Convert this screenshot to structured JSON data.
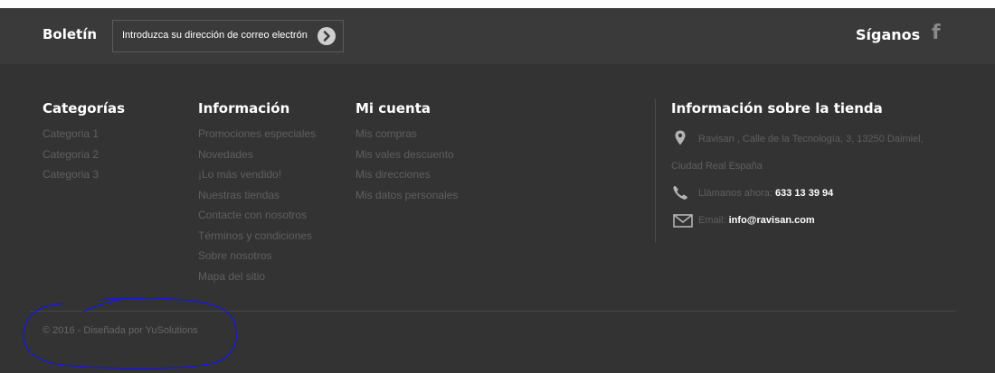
{
  "newsletter": {
    "title": "Boletín",
    "input_text": "Introduzca su dirección de correo electrón",
    "submit_icon": "chevron-right-circle-icon"
  },
  "social": {
    "title": "Síganos",
    "icon": "facebook-icon"
  },
  "columns": {
    "categorias": {
      "title": "Categorías",
      "items": [
        "Categoria 1",
        "Categoria 2",
        "Categoria 3"
      ]
    },
    "informacion": {
      "title": "Información",
      "items": [
        "Promociones especiales",
        "Novedades",
        "¡Lo más vendido!",
        "Nuestras tiendas",
        "Contacte con nosotros",
        "Términos y condiciones",
        "Sobre nosotros",
        "Mapa del sitio"
      ]
    },
    "cuenta": {
      "title": "Mi cuenta",
      "items": [
        "Mis compras",
        "Mis vales descuento",
        "Mis direcciones",
        "Mis datos personales"
      ]
    }
  },
  "store": {
    "title": "Información sobre la tienda",
    "address_line1": "Ravisan , Calle de la Tecnología, 3, 13250 Daimiel,",
    "address_line2": "Ciudad Real España",
    "phone_label": "Llámanos ahora:",
    "phone": "633 13 39 94",
    "email_label": "Email:",
    "email": "info@ravisan.com",
    "icons": [
      "map-marker-icon",
      "phone-icon",
      "envelope-icon"
    ]
  },
  "copyright": "© 2016 - Diseñada por YuSolutions",
  "colors": {
    "newsletter_bg": "#3a3a3a",
    "footer_bg": "#333333",
    "link": "#5f5f5f",
    "heading": "#ffffff",
    "annotation": "#1a1ad0"
  }
}
